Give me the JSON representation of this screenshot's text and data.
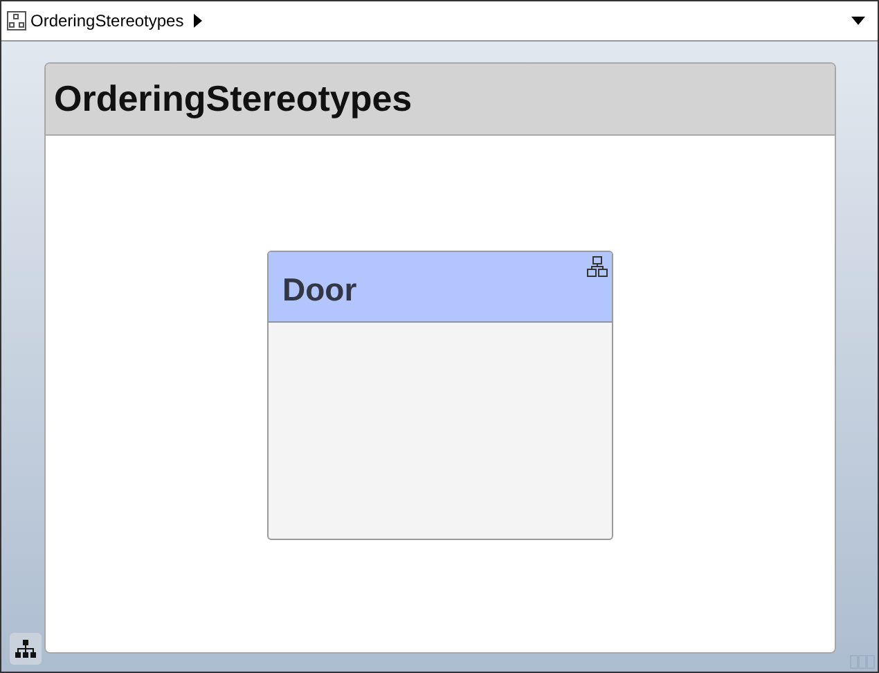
{
  "breadcrumb": {
    "label": "OrderingStereotypes"
  },
  "diagram": {
    "title": "OrderingStereotypes",
    "components": [
      {
        "name": "Door"
      }
    ]
  }
}
